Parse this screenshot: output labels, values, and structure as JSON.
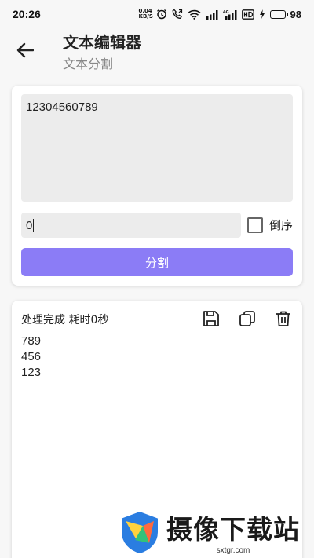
{
  "status_bar": {
    "time": "20:26",
    "net_speed_value": "0.04",
    "net_speed_unit": "KB/S",
    "battery_level": "98",
    "icons": [
      "alarm-icon",
      "call-icon",
      "wifi-icon",
      "signal-icon",
      "signal-4g-icon",
      "hd-icon",
      "charging-icon",
      "battery-icon"
    ]
  },
  "header": {
    "title": "文本编辑器",
    "subtitle": "文本分割",
    "back_icon": "arrow-left-icon"
  },
  "editor": {
    "input_text": "12304560789",
    "separator_value": "0",
    "reverse_label": "倒序",
    "reverse_checked": false,
    "split_button_label": "分割",
    "accent_color": "#8b7cf6"
  },
  "result": {
    "status_text": "处理完成 耗时0秒",
    "tools": [
      "save-icon",
      "copy-icon",
      "delete-icon"
    ],
    "lines": [
      "789",
      "456",
      "123"
    ]
  },
  "watermark": {
    "name": "摄像下载站",
    "url": "sxtgr.com"
  }
}
